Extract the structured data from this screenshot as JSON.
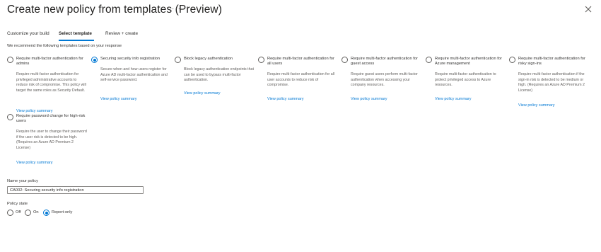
{
  "header": {
    "title": "Create new policy from templates (Preview)",
    "more_label": "···"
  },
  "tabs": [
    {
      "label": "Customize your build",
      "active": false
    },
    {
      "label": "Select template",
      "active": true
    },
    {
      "label": "Review + create",
      "active": false
    }
  ],
  "intro": "We recommend the following templates based on your response",
  "templates": [
    {
      "name": "Require multi-factor authentication for admins",
      "description": "Require multi-factor authentication for privileged administrative accounts to reduce risk of compromise. This policy will target the same roles as Security Default.",
      "link": "View policy summary",
      "selected": false
    },
    {
      "name": "Securing security info registration",
      "description": "Secure when and how users register for Azure AD multi-factor authentication and self-service password.",
      "link": "View policy summary",
      "selected": true
    },
    {
      "name": "Block legacy authentication",
      "description": "Block legacy authentication endpoints that can be used to bypass multi-factor authentication.",
      "link": "View policy summary",
      "selected": false
    },
    {
      "name": "Require multi-factor authentication for all users",
      "description": "Require multi-factor authentication for all user accounts to reduce risk of compromise.",
      "link": "View policy summary",
      "selected": false
    },
    {
      "name": "Require multi-factor authentication for guest access",
      "description": "Require guest users perform multi-factor authentication when accessing your company resources.",
      "link": "View policy summary",
      "selected": false
    },
    {
      "name": "Require multi-factor authentication for Azure management",
      "description": "Require multi-factor authentication to protect privileged access to Azure resources.",
      "link": "View policy summary",
      "selected": false
    },
    {
      "name": "Require multi-factor authentication for risky sign-ins",
      "description": "Require multi-factor authentication if the sign-in risk is detected to be medium or high. (Requires an Azure AD Premium 2 License)",
      "link": "View policy summary",
      "selected": false
    },
    {
      "name": "Require password change for high-risk users",
      "description": "Require the user to change their password if the user risk is detected to be high. (Requires an Azure AD Premium 2 License)",
      "link": "View policy summary",
      "selected": false
    }
  ],
  "policy_name": {
    "label": "Name your policy",
    "value": "CA002: Securing security info registration"
  },
  "policy_state": {
    "label": "Policy state",
    "options": [
      {
        "label": "Off",
        "selected": false
      },
      {
        "label": "On",
        "selected": false
      },
      {
        "label": "Report-only",
        "selected": true
      }
    ]
  },
  "colors": {
    "accent": "#0078d4",
    "text": "#323130",
    "muted_text": "#605e5c"
  }
}
